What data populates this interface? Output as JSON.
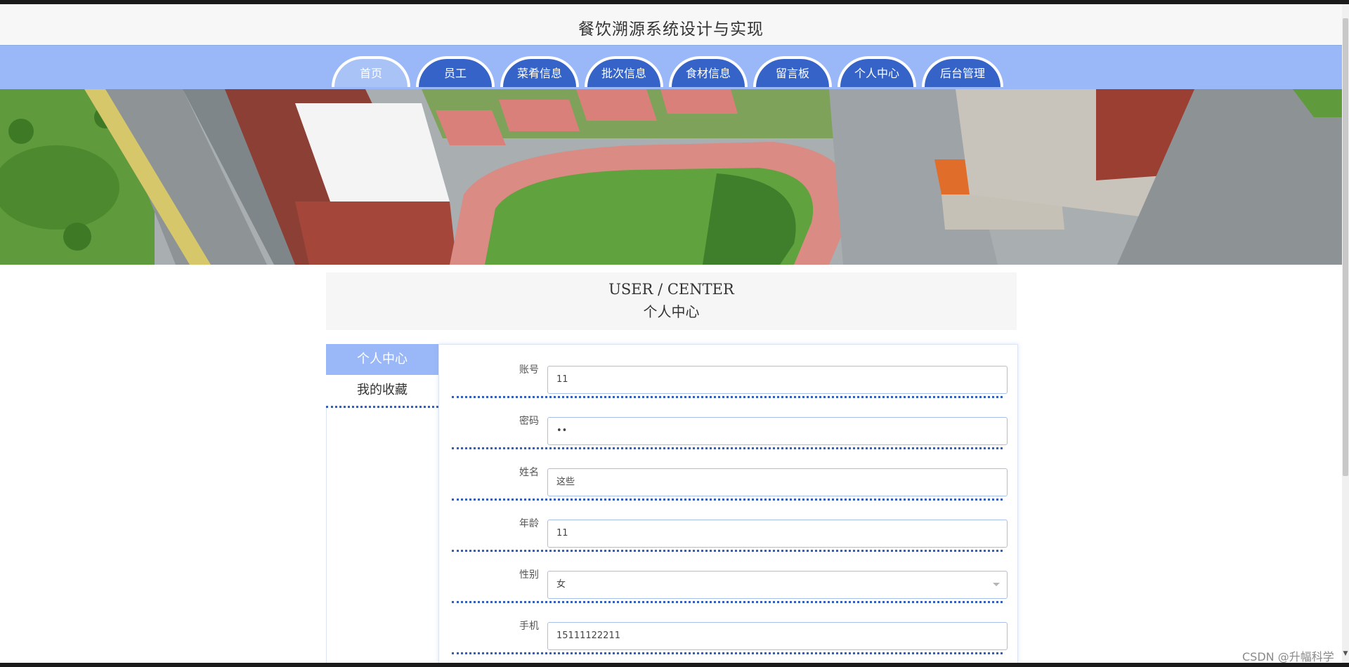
{
  "site": {
    "title": "餐饮溯源系统设计与实现"
  },
  "nav": {
    "items": [
      {
        "label": "首页",
        "active": true
      },
      {
        "label": "员工"
      },
      {
        "label": "菜肴信息"
      },
      {
        "label": "批次信息"
      },
      {
        "label": "食材信息"
      },
      {
        "label": "留言板"
      },
      {
        "label": "个人中心"
      },
      {
        "label": "后台管理"
      }
    ]
  },
  "banner": {
    "slide_count": 3,
    "active_slide": 1
  },
  "section": {
    "title_en": "USER / CENTER",
    "title_cn": "个人中心"
  },
  "sidebar": {
    "items": [
      {
        "label": "个人中心",
        "active": true
      },
      {
        "label": "我的收藏"
      }
    ]
  },
  "form": {
    "fields": [
      {
        "label": "账号",
        "value": "11"
      },
      {
        "label": "密码",
        "value": "••"
      },
      {
        "label": "姓名",
        "value": "这些"
      },
      {
        "label": "年龄",
        "value": "11"
      },
      {
        "label": "性别",
        "value": "女"
      },
      {
        "label": "手机",
        "value": "15111122211"
      }
    ]
  },
  "watermark": {
    "text": "CSDN @升幅科学"
  },
  "colors": {
    "nav_bg": "#9ab8f7",
    "tab_bg": "#3563c8",
    "accent": "#3a5fb0"
  }
}
